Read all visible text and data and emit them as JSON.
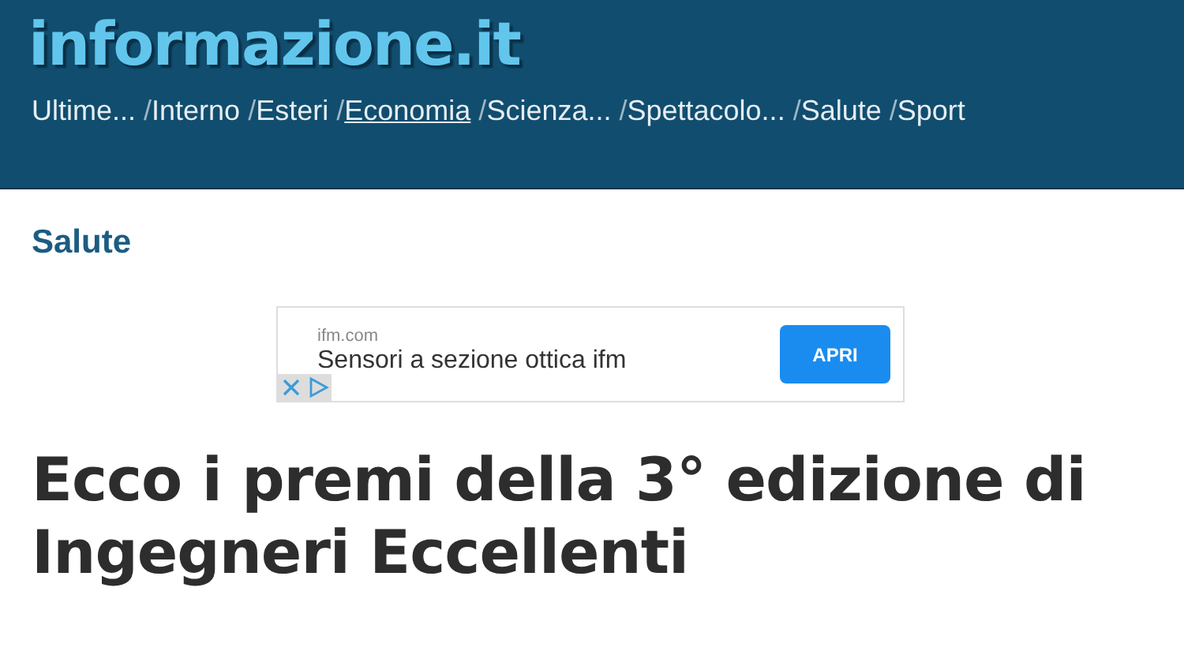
{
  "header": {
    "logo": "informazione.it",
    "nav": [
      {
        "label": "Ultime...",
        "selected": false
      },
      {
        "prefix": "/",
        "label": "Interno",
        "selected": false
      },
      {
        "prefix": "/",
        "label": "Esteri",
        "selected": false
      },
      {
        "prefix": "/",
        "label": "Economia",
        "selected": true
      },
      {
        "prefix": "/",
        "label": "Scienza...",
        "selected": false
      },
      {
        "prefix": "/",
        "label": "Spettacolo...",
        "selected": false
      },
      {
        "prefix": "/",
        "label": "Salute",
        "selected": false
      },
      {
        "prefix": "/",
        "label": "Sport",
        "selected": false
      }
    ]
  },
  "section": "Salute",
  "ad": {
    "domain": "ifm.com",
    "headline": "Sensori a sezione ottica ifm",
    "button": "APRI"
  },
  "article": {
    "title": "Ecco i premi della 3° edizione di Ingegneri Eccellenti"
  }
}
